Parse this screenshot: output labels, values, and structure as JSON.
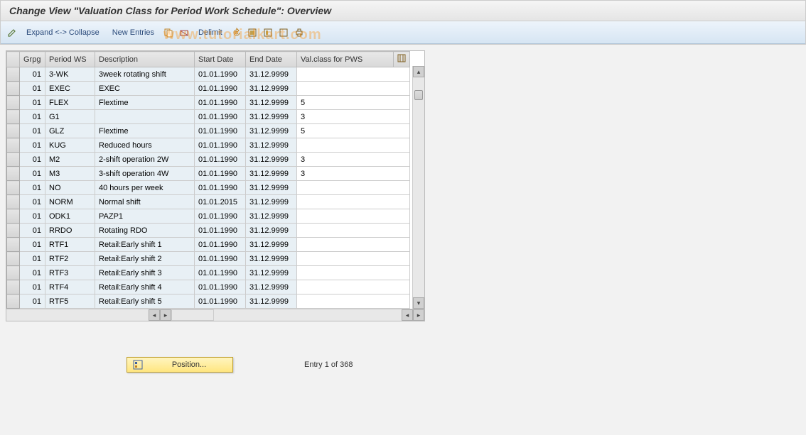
{
  "title": "Change View \"Valuation Class for Period Work Schedule\": Overview",
  "toolbar": {
    "expand_collapse": "Expand <-> Collapse",
    "new_entries": "New Entries",
    "delimit": "Delimit"
  },
  "columns": {
    "grpg": "Grpg",
    "pws": "Period WS",
    "desc": "Description",
    "start": "Start Date",
    "end": "End Date",
    "val": "Val.class for PWS"
  },
  "rows": [
    {
      "grpg": "01",
      "pws": "3-WK",
      "desc": "3week rotating shift",
      "start": "01.01.1990",
      "end": "31.12.9999",
      "val": ""
    },
    {
      "grpg": "01",
      "pws": "EXEC",
      "desc": "EXEC",
      "start": "01.01.1990",
      "end": "31.12.9999",
      "val": ""
    },
    {
      "grpg": "01",
      "pws": "FLEX",
      "desc": "Flextime",
      "start": "01.01.1990",
      "end": "31.12.9999",
      "val": "5"
    },
    {
      "grpg": "01",
      "pws": "G1",
      "desc": "",
      "start": "01.01.1990",
      "end": "31.12.9999",
      "val": "3"
    },
    {
      "grpg": "01",
      "pws": "GLZ",
      "desc": "Flextime",
      "start": "01.01.1990",
      "end": "31.12.9999",
      "val": "5"
    },
    {
      "grpg": "01",
      "pws": "KUG",
      "desc": "Reduced hours",
      "start": "01.01.1990",
      "end": "31.12.9999",
      "val": ""
    },
    {
      "grpg": "01",
      "pws": "M2",
      "desc": "2-shift operation 2W",
      "start": "01.01.1990",
      "end": "31.12.9999",
      "val": "3"
    },
    {
      "grpg": "01",
      "pws": "M3",
      "desc": "3-shift operation 4W",
      "start": "01.01.1990",
      "end": "31.12.9999",
      "val": "3"
    },
    {
      "grpg": "01",
      "pws": "NO",
      "desc": "40 hours per week",
      "start": "01.01.1990",
      "end": "31.12.9999",
      "val": ""
    },
    {
      "grpg": "01",
      "pws": "NORM",
      "desc": "Normal shift",
      "start": "01.01.2015",
      "end": "31.12.9999",
      "val": ""
    },
    {
      "grpg": "01",
      "pws": "ODK1",
      "desc": "PAZP1",
      "start": "01.01.1990",
      "end": "31.12.9999",
      "val": ""
    },
    {
      "grpg": "01",
      "pws": "RRDO",
      "desc": "Rotating RDO",
      "start": "01.01.1990",
      "end": "31.12.9999",
      "val": ""
    },
    {
      "grpg": "01",
      "pws": "RTF1",
      "desc": "Retail:Early shift 1",
      "start": "01.01.1990",
      "end": "31.12.9999",
      "val": ""
    },
    {
      "grpg": "01",
      "pws": "RTF2",
      "desc": "Retail:Early shift 2",
      "start": "01.01.1990",
      "end": "31.12.9999",
      "val": ""
    },
    {
      "grpg": "01",
      "pws": "RTF3",
      "desc": "Retail:Early shift 3",
      "start": "01.01.1990",
      "end": "31.12.9999",
      "val": ""
    },
    {
      "grpg": "01",
      "pws": "RTF4",
      "desc": "Retail:Early shift 4",
      "start": "01.01.1990",
      "end": "31.12.9999",
      "val": ""
    },
    {
      "grpg": "01",
      "pws": "RTF5",
      "desc": "Retail:Early shift 5",
      "start": "01.01.1990",
      "end": "31.12.9999",
      "val": ""
    }
  ],
  "footer": {
    "position_label": "Position...",
    "entry_text": "Entry 1 of 368"
  },
  "watermark": "www.tutorialkart.com"
}
